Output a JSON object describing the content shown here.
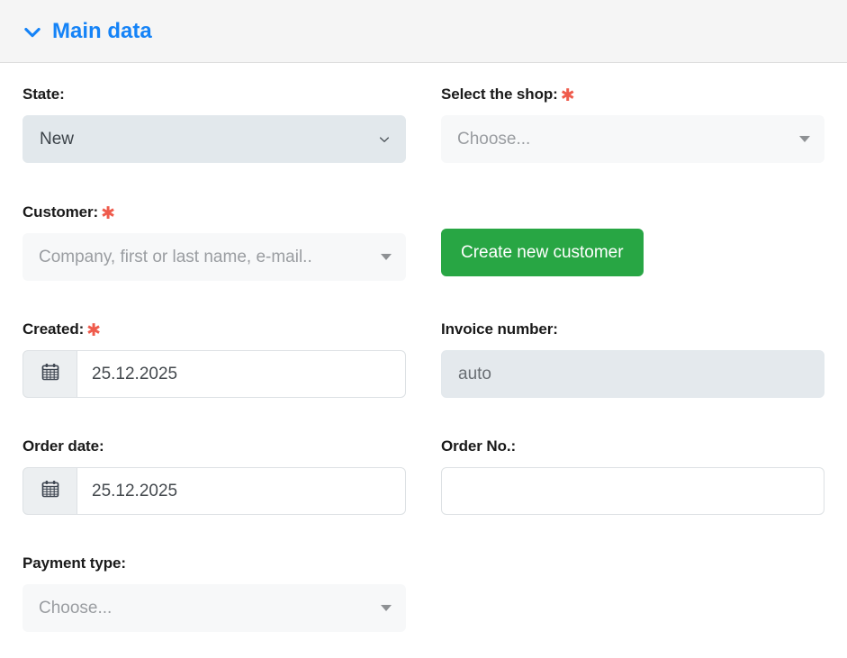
{
  "panel": {
    "title": "Main data",
    "toggle_icon": "chevron-down-icon",
    "accent_color": "#1583f7",
    "header_bg": "#f5f5f5"
  },
  "required_marker": "✱",
  "required_color": "#ef5b4c",
  "fields": {
    "state": {
      "label": "State:",
      "required": false,
      "type": "select",
      "value": "New",
      "options": [
        "New"
      ],
      "icon": "chevron-down-icon",
      "bg": "#e2e8ec"
    },
    "shop": {
      "label": "Select the shop:",
      "required": true,
      "type": "select2",
      "value": "",
      "placeholder": "Choose...",
      "icon": "caret-down-icon",
      "bg": "#f7f8f9"
    },
    "customer": {
      "label": "Customer:",
      "required": true,
      "type": "select2",
      "value": "",
      "placeholder": "Company, first or last name, e-mail..",
      "icon": "caret-down-icon",
      "bg": "#f7f8f9"
    },
    "created": {
      "label": "Created:",
      "required": true,
      "type": "date",
      "value": "25.12.2025",
      "icon": "calendar-icon"
    },
    "invoice_number": {
      "label": "Invoice number:",
      "required": false,
      "type": "text-disabled",
      "value": "auto",
      "bg": "#e4e9ed"
    },
    "order_date": {
      "label": "Order date:",
      "required": false,
      "type": "date",
      "value": "25.12.2025",
      "icon": "calendar-icon"
    },
    "order_no": {
      "label": "Order No.:",
      "required": false,
      "type": "text",
      "value": "",
      "placeholder": ""
    },
    "payment_type": {
      "label": "Payment type:",
      "required": false,
      "type": "select2",
      "value": "",
      "placeholder": "Choose...",
      "icon": "caret-down-icon",
      "bg": "#f7f8f9"
    }
  },
  "buttons": {
    "create_customer": {
      "label": "Create new customer",
      "color": "#28a644",
      "text_color": "#ffffff"
    }
  }
}
